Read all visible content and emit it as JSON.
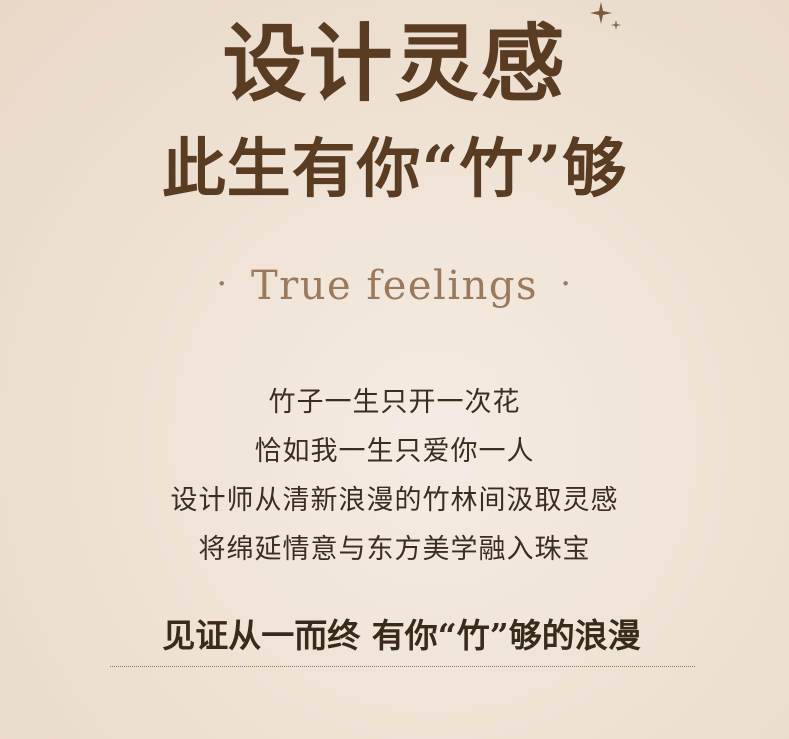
{
  "title_line1": "设计灵感",
  "title_line2": "此生有你“竹”够",
  "subtitle": {
    "dot_left": "·",
    "text": "True feelings",
    "dot_right": "·"
  },
  "poem_lines": [
    "竹子一生只开一次花",
    "恰如我一生只爱你一人",
    "设计师从清新浪漫的竹林间汲取灵感",
    "将绵延情意与东方美学融入珠宝"
  ],
  "closing_line": "见证从一而终 有你“竹”够的浪漫",
  "colors": {
    "title": "#5a3c22",
    "subtitle": "#9a7a5b",
    "body": "#3a2d22",
    "background": "#efe3d6"
  },
  "icons": {
    "decoration": "sparkle-icon"
  }
}
